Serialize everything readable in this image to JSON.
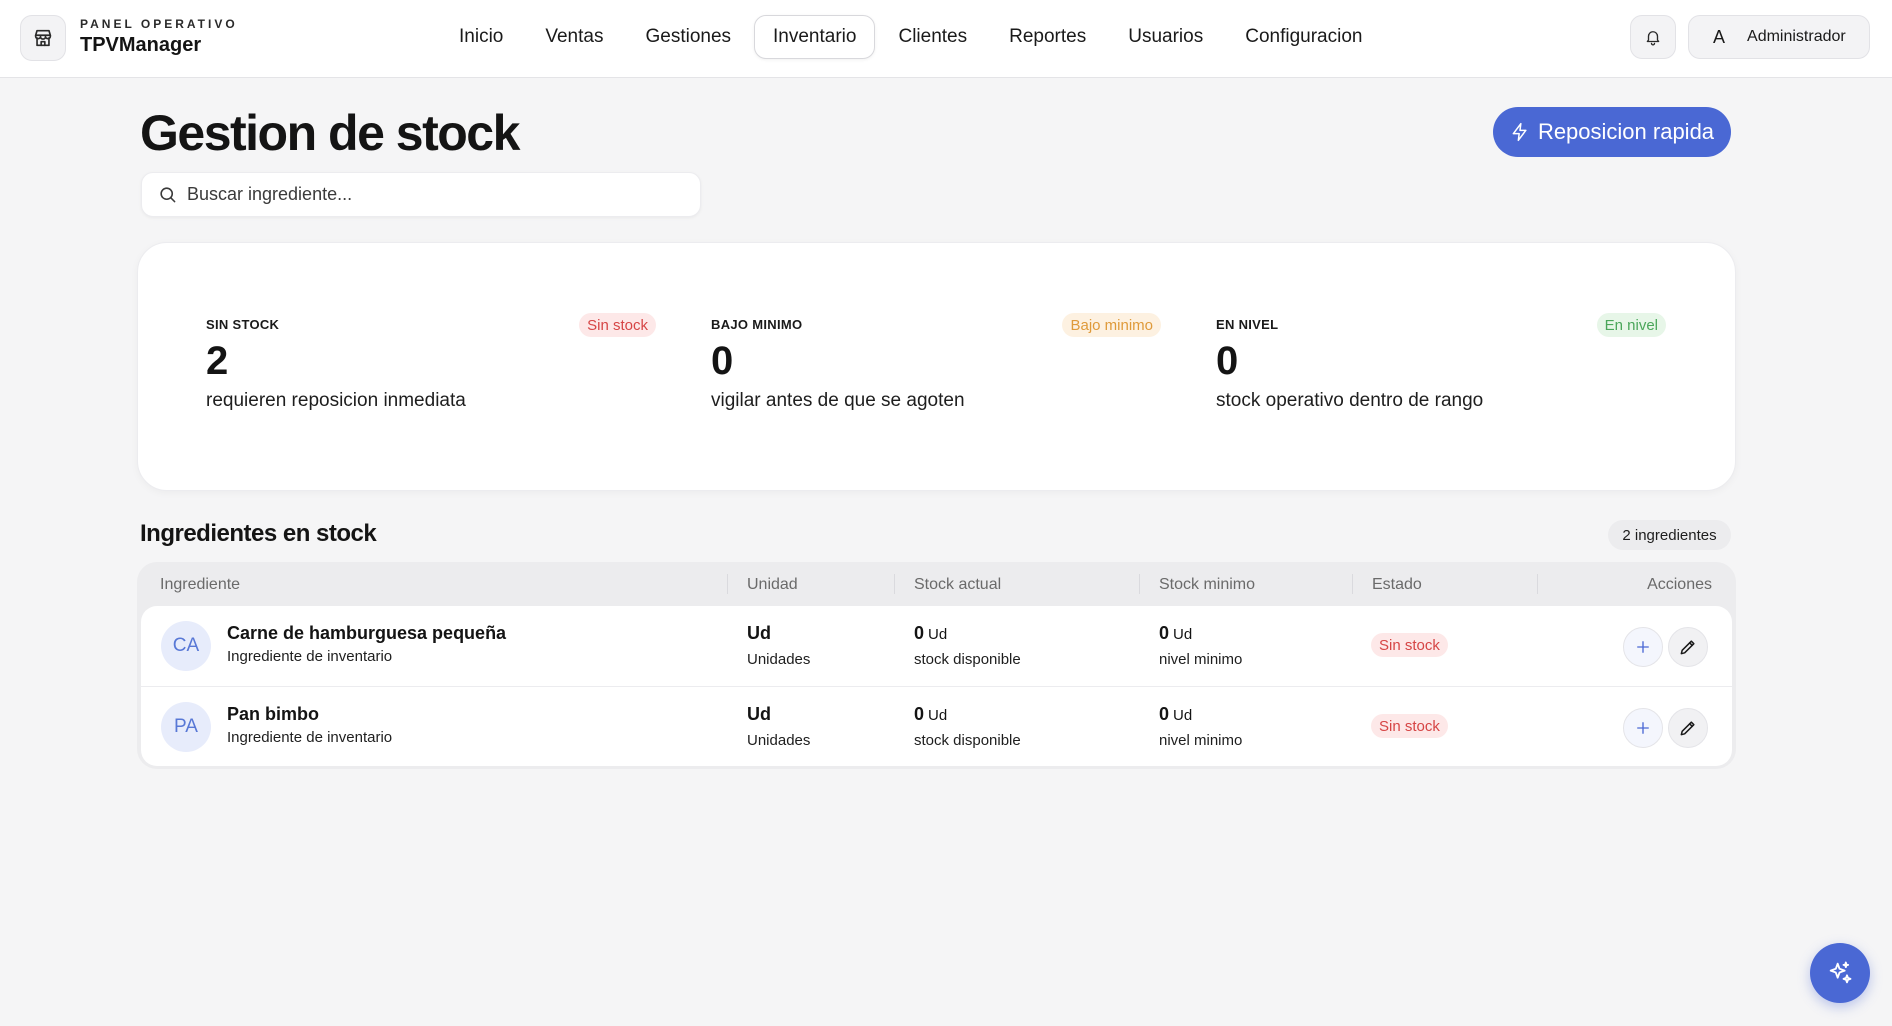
{
  "brand": {
    "eyebrow": "PANEL OPERATIVO",
    "name": "TPVManager",
    "icon": "store-icon"
  },
  "nav": {
    "items": [
      "Inicio",
      "Ventas",
      "Gestiones",
      "Inventario",
      "Clientes",
      "Reportes",
      "Usuarios",
      "Configuracion"
    ],
    "active": "Inventario"
  },
  "user": {
    "initial": "A",
    "name": "Administrador"
  },
  "page": {
    "title": "Gestion de stock",
    "quick_button": "Reposicion rapida"
  },
  "search": {
    "placeholder": "Buscar ingrediente...",
    "value": ""
  },
  "summary": [
    {
      "label": "SIN STOCK",
      "badge": "Sin stock",
      "value": "2",
      "description": "requieren reposicion inmediata",
      "tone": "red"
    },
    {
      "label": "BAJO MINIMO",
      "badge": "Bajo minimo",
      "value": "0",
      "description": "vigilar antes de que se agoten",
      "tone": "amber"
    },
    {
      "label": "EN NIVEL",
      "badge": "En nivel",
      "value": "0",
      "description": "stock operativo dentro de rango",
      "tone": "green"
    }
  ],
  "ingredients": {
    "title": "Ingredientes en stock",
    "count": "2 ingredientes",
    "columns": [
      "Ingrediente",
      "Unidad",
      "Stock actual",
      "Stock minimo",
      "Estado",
      "Acciones"
    ],
    "rows": [
      {
        "initials": "CA",
        "name": "Carne de hamburguesa pequeña",
        "subtitle": "Ingrediente de inventario",
        "unit": "Ud",
        "unit_name": "Unidades",
        "stock": "0",
        "stock_unit": "Ud",
        "stock_label": "stock disponible",
        "min": "0",
        "min_unit": "Ud",
        "min_label": "nivel minimo",
        "status": "Sin stock"
      },
      {
        "initials": "PA",
        "name": "Pan bimbo",
        "subtitle": "Ingrediente de inventario",
        "unit": "Ud",
        "unit_name": "Unidades",
        "stock": "0",
        "stock_unit": "Ud",
        "stock_label": "stock disponible",
        "min": "0",
        "min_unit": "Ud",
        "min_label": "nivel minimo",
        "status": "Sin stock"
      }
    ]
  },
  "colors": {
    "accent": "#4a68d4",
    "danger": "#d64545",
    "warning": "#df9a3a",
    "success": "#4aa65a",
    "background": "#f5f5f6"
  }
}
